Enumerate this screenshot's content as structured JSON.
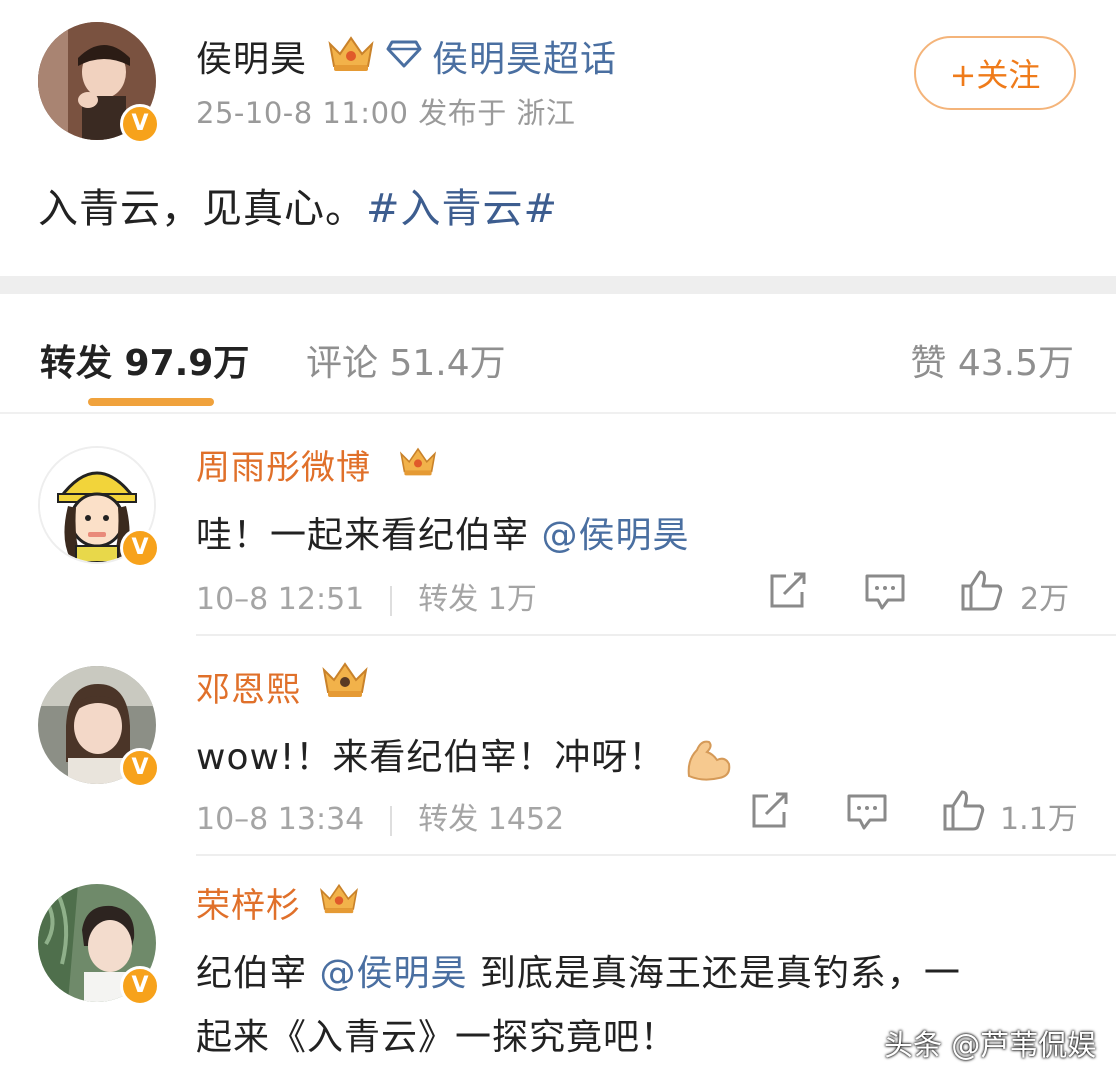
{
  "post": {
    "author": "侯明昊",
    "supertopic": "侯明昊超话",
    "meta": "25-10-8 11:00  发布于 浙江",
    "follow_label": "+关注",
    "text": "入青云，见真心。",
    "hashtag": "#入青云#"
  },
  "stats": {
    "repost": "转发 97.9万",
    "comment": "评论 51.4万",
    "like": "赞 43.5万"
  },
  "comments": [
    {
      "name": "周雨彤微博",
      "text_before": "哇！一起来看纪伯宰 ",
      "mention": "@侯明昊",
      "text_after": "",
      "time": "10–8 12:51",
      "repost": "转发 1万",
      "likes": "2万"
    },
    {
      "name": "邓恩熙",
      "text_before": "wow!！来看纪伯宰！冲呀！",
      "mention": "",
      "text_after": "",
      "time": "10–8 13:34",
      "repost": "转发 1452",
      "likes": "1.1万"
    },
    {
      "name": "荣梓杉",
      "text_before": "纪伯宰 ",
      "mention": "@侯明昊",
      "text_after": " 到底是真海王还是真钓系，一",
      "text_line2": "起来《入青云》一探究竟吧！",
      "time": "",
      "repost": "",
      "likes": ""
    }
  ],
  "watermark": "头条 @芦苇侃娱",
  "icons": {
    "verified": "v-badge-icon",
    "crown": "crown-icon",
    "supertopic": "diamond-icon",
    "share": "share-icon",
    "comment": "comment-icon",
    "like": "thumbs-up-icon"
  },
  "colors": {
    "name_orange": "#e0702a",
    "link_blue": "#4a6fa1",
    "badge": "#f7a21b",
    "tab_underline": "#f0a23c"
  }
}
